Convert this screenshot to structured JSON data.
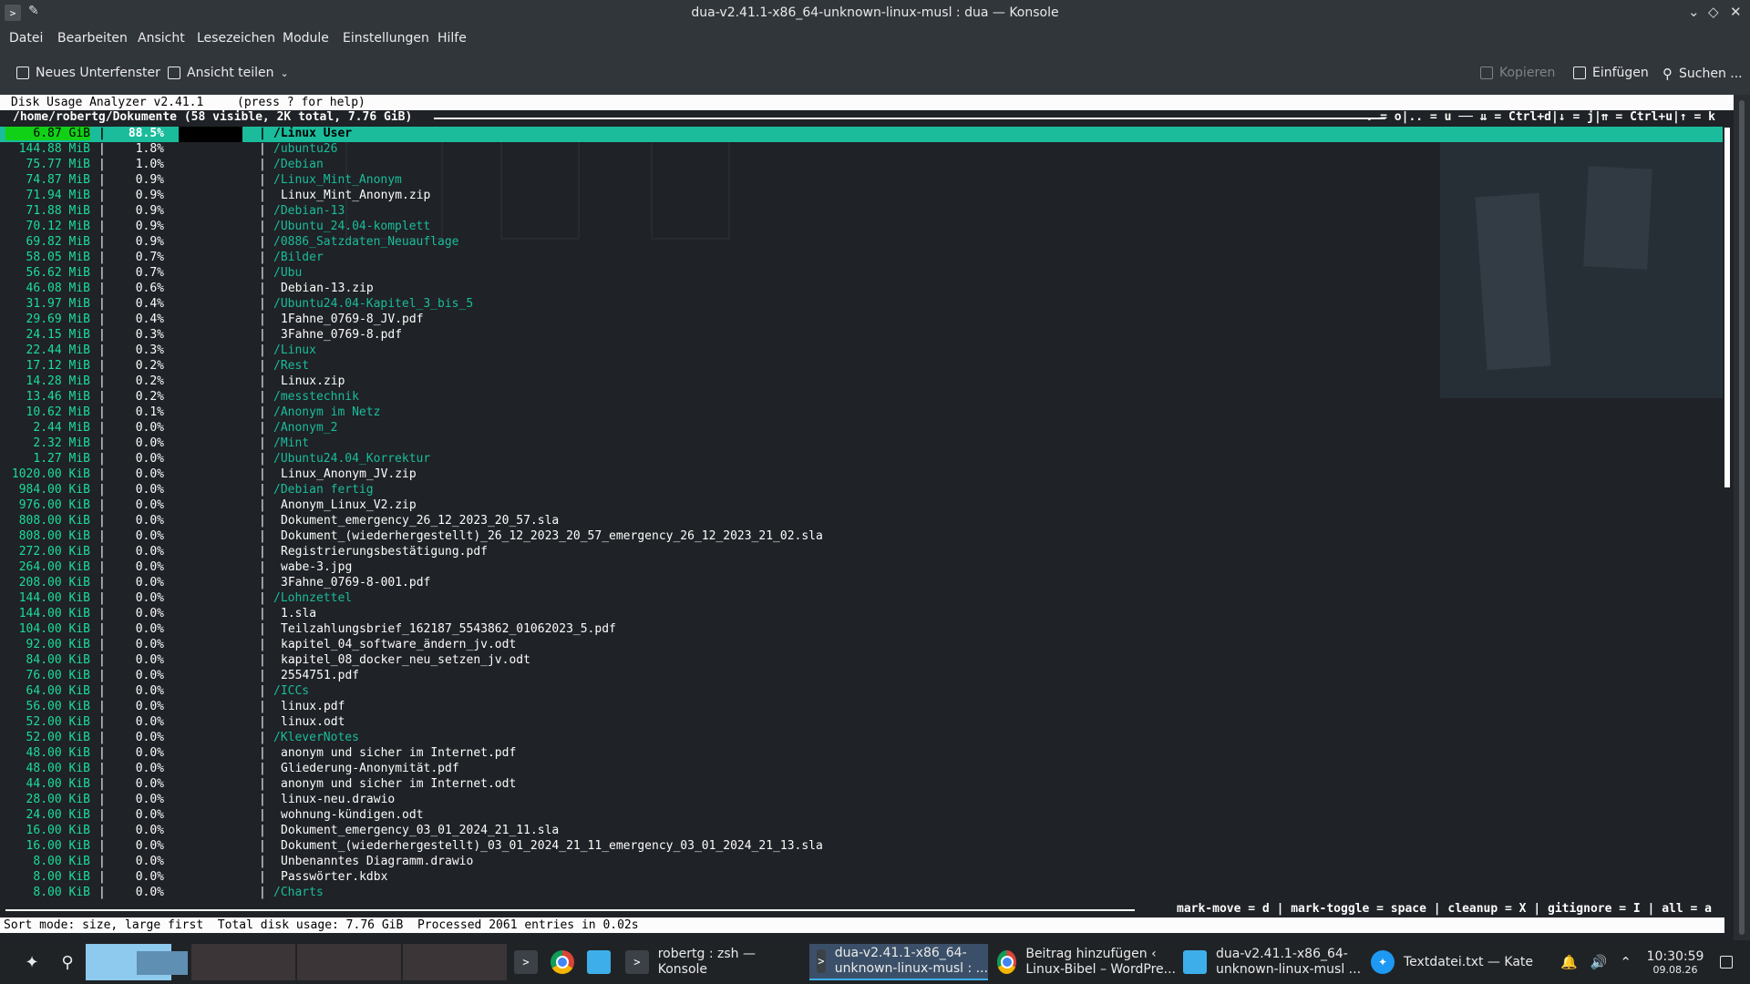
{
  "window": {
    "title": "dua-v2.41.1-x86_64-unknown-linux-musl : dua — Konsole",
    "buttons": [
      "⌄",
      "◇",
      "✕"
    ]
  },
  "menu": [
    "Datei",
    "Bearbeiten",
    "Ansicht",
    "Lesezeichen",
    "Module",
    "Einstellungen",
    "Hilfe"
  ],
  "toolbar": {
    "new_tab": "Neues Unterfenster",
    "split_view": "Ansicht teilen",
    "copy": "Kopieren",
    "paste": "Einfügen",
    "search": "Suchen ..."
  },
  "dua": {
    "header": "Disk Usage Analyzer v2.41.1",
    "help_hint": "(press ? for help)",
    "path_info": "/home/robertg/Dokumente (58 visible, 2K total, 7.76 GiB)",
    "nav_keys": ". = o|.. = u ── ⇊ = Ctrl+d|↓ = j|⇈ = Ctrl+u|↑ = k",
    "bottom_keys": "mark-move = d | mark-toggle = space | cleanup = X | gitignore = I | all = a",
    "status": "Sort mode: size, large first  Total disk usage: 7.76 GiB  Processed 2061 entries in 0.02s",
    "entries": [
      {
        "size": "6.87 GiB",
        "pct": "88.5%",
        "name": "/Linux User",
        "dir": true,
        "selected": true
      },
      {
        "size": "144.88 MiB",
        "pct": "1.8%",
        "name": "/ubuntu26",
        "dir": true
      },
      {
        "size": "75.77 MiB",
        "pct": "1.0%",
        "name": "/Debian",
        "dir": true
      },
      {
        "size": "74.87 MiB",
        "pct": "0.9%",
        "name": "/Linux_Mint_Anonym",
        "dir": true
      },
      {
        "size": "71.94 MiB",
        "pct": "0.9%",
        "name": "Linux_Mint_Anonym.zip",
        "dir": false
      },
      {
        "size": "71.88 MiB",
        "pct": "0.9%",
        "name": "/Debian-13",
        "dir": true
      },
      {
        "size": "70.12 MiB",
        "pct": "0.9%",
        "name": "/Ubuntu_24.04-komplett",
        "dir": true
      },
      {
        "size": "69.82 MiB",
        "pct": "0.9%",
        "name": "/0886_Satzdaten_Neuauflage",
        "dir": true
      },
      {
        "size": "58.05 MiB",
        "pct": "0.7%",
        "name": "/Bilder",
        "dir": true
      },
      {
        "size": "56.62 MiB",
        "pct": "0.7%",
        "name": "/Ubu",
        "dir": true
      },
      {
        "size": "46.08 MiB",
        "pct": "0.6%",
        "name": "Debian-13.zip",
        "dir": false
      },
      {
        "size": "31.97 MiB",
        "pct": "0.4%",
        "name": "/Ubuntu24.04-Kapitel_3_bis_5",
        "dir": true
      },
      {
        "size": "29.69 MiB",
        "pct": "0.4%",
        "name": "1Fahne_0769-8_JV.pdf",
        "dir": false
      },
      {
        "size": "24.15 MiB",
        "pct": "0.3%",
        "name": "3Fahne_0769-8.pdf",
        "dir": false
      },
      {
        "size": "22.44 MiB",
        "pct": "0.3%",
        "name": "/Linux",
        "dir": true
      },
      {
        "size": "17.12 MiB",
        "pct": "0.2%",
        "name": "/Rest",
        "dir": true
      },
      {
        "size": "14.28 MiB",
        "pct": "0.2%",
        "name": "Linux.zip",
        "dir": false
      },
      {
        "size": "13.46 MiB",
        "pct": "0.2%",
        "name": "/messtechnik",
        "dir": true
      },
      {
        "size": "10.62 MiB",
        "pct": "0.1%",
        "name": "/Anonym im Netz",
        "dir": true
      },
      {
        "size": "2.44 MiB",
        "pct": "0.0%",
        "name": "/Anonym_2",
        "dir": true
      },
      {
        "size": "2.32 MiB",
        "pct": "0.0%",
        "name": "/Mint",
        "dir": true
      },
      {
        "size": "1.27 MiB",
        "pct": "0.0%",
        "name": "/Ubuntu24.04_Korrektur",
        "dir": true
      },
      {
        "size": "1020.00 KiB",
        "pct": "0.0%",
        "name": "Linux_Anonym_JV.zip",
        "dir": false
      },
      {
        "size": "984.00 KiB",
        "pct": "0.0%",
        "name": "/Debian fertig",
        "dir": true
      },
      {
        "size": "976.00 KiB",
        "pct": "0.0%",
        "name": "Anonym_Linux_V2.zip",
        "dir": false
      },
      {
        "size": "808.00 KiB",
        "pct": "0.0%",
        "name": "Dokument_emergency_26_12_2023_20_57.sla",
        "dir": false
      },
      {
        "size": "808.00 KiB",
        "pct": "0.0%",
        "name": "Dokument_(wiederhergestellt)_26_12_2023_20_57_emergency_26_12_2023_21_02.sla",
        "dir": false
      },
      {
        "size": "272.00 KiB",
        "pct": "0.0%",
        "name": "Registrierungsbestätigung.pdf",
        "dir": false
      },
      {
        "size": "264.00 KiB",
        "pct": "0.0%",
        "name": "wabe-3.jpg",
        "dir": false
      },
      {
        "size": "208.00 KiB",
        "pct": "0.0%",
        "name": "3Fahne_0769-8-001.pdf",
        "dir": false
      },
      {
        "size": "144.00 KiB",
        "pct": "0.0%",
        "name": "/Lohnzettel",
        "dir": true
      },
      {
        "size": "144.00 KiB",
        "pct": "0.0%",
        "name": "1.sla",
        "dir": false
      },
      {
        "size": "104.00 KiB",
        "pct": "0.0%",
        "name": "Teilzahlungsbrief_162187_5543862_01062023_5.pdf",
        "dir": false
      },
      {
        "size": "92.00 KiB",
        "pct": "0.0%",
        "name": "kapitel_04_software_ändern_jv.odt",
        "dir": false
      },
      {
        "size": "84.00 KiB",
        "pct": "0.0%",
        "name": "kapitel_08_docker_neu_setzen_jv.odt",
        "dir": false
      },
      {
        "size": "76.00 KiB",
        "pct": "0.0%",
        "name": "2554751.pdf",
        "dir": false
      },
      {
        "size": "64.00 KiB",
        "pct": "0.0%",
        "name": "/ICCs",
        "dir": true
      },
      {
        "size": "56.00 KiB",
        "pct": "0.0%",
        "name": "linux.pdf",
        "dir": false
      },
      {
        "size": "52.00 KiB",
        "pct": "0.0%",
        "name": "linux.odt",
        "dir": false
      },
      {
        "size": "52.00 KiB",
        "pct": "0.0%",
        "name": "/KleverNotes",
        "dir": true
      },
      {
        "size": "48.00 KiB",
        "pct": "0.0%",
        "name": "anonym und sicher im Internet.pdf",
        "dir": false
      },
      {
        "size": "48.00 KiB",
        "pct": "0.0%",
        "name": "Gliederung-Anonymität.pdf",
        "dir": false
      },
      {
        "size": "44.00 KiB",
        "pct": "0.0%",
        "name": "anonym und sicher im Internet.odt",
        "dir": false
      },
      {
        "size": "28.00 KiB",
        "pct": "0.0%",
        "name": "linux-neu.drawio",
        "dir": false
      },
      {
        "size": "24.00 KiB",
        "pct": "0.0%",
        "name": "wohnung-kündigen.odt",
        "dir": false
      },
      {
        "size": "16.00 KiB",
        "pct": "0.0%",
        "name": "Dokument_emergency_03_01_2024_21_11.sla",
        "dir": false
      },
      {
        "size": "16.00 KiB",
        "pct": "0.0%",
        "name": "Dokument_(wiederhergestellt)_03_01_2024_21_11_emergency_03_01_2024_21_13.sla",
        "dir": false
      },
      {
        "size": "8.00 KiB",
        "pct": "0.0%",
        "name": "Unbenanntes Diagramm.drawio",
        "dir": false
      },
      {
        "size": "8.00 KiB",
        "pct": "0.0%",
        "name": "Passwörter.kdbx",
        "dir": false
      },
      {
        "size": "8.00 KiB",
        "pct": "0.0%",
        "name": "/Charts",
        "dir": true
      }
    ]
  },
  "taskbar": {
    "tasks": [
      {
        "label": "robertg : zsh — Konsole",
        "icon": "terminal-icon"
      },
      {
        "label": "dua-v2.41.1-x86_64-\nunknown-linux-musl : ...",
        "icon": "terminal-icon",
        "active": true
      },
      {
        "label": "Beitrag hinzufügen ‹\nLinux-Bibel – WordPre...",
        "icon": "chrome-icon"
      },
      {
        "label": "dua-v2.41.1-x86_64-\nunknown-linux-musl ...",
        "icon": "folder-icon"
      },
      {
        "label": "Textdatei.txt — Kate",
        "icon": "kate-icon"
      }
    ],
    "time": "10:30:59",
    "date": "09.08.26"
  },
  "colors": {
    "accent": "#1abc9c",
    "selected_size_bg": "#11d116",
    "terminal_bg": "#1f2226",
    "chrome_bg": "#31363b"
  }
}
